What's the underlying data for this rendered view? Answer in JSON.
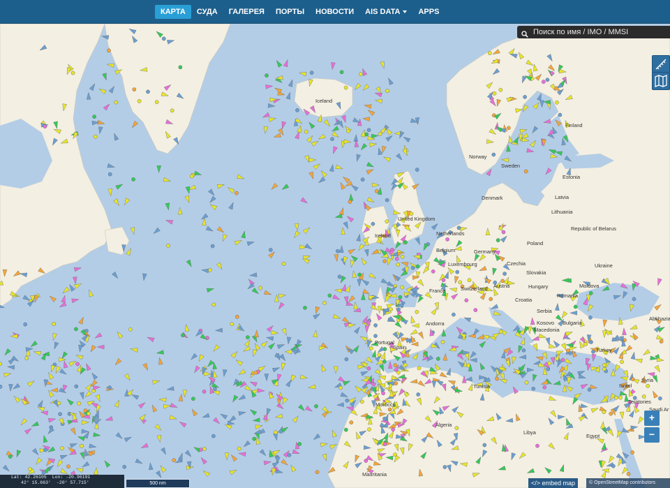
{
  "nav": {
    "items": [
      {
        "label": "КАРТА",
        "active": true
      },
      {
        "label": "СУДА"
      },
      {
        "label": "ГАЛЕРЕЯ"
      },
      {
        "label": "ПОРТЫ"
      },
      {
        "label": "НОВОСТИ"
      },
      {
        "label": "AIS DATA",
        "dropdown": true
      },
      {
        "label": "APPS"
      }
    ]
  },
  "search": {
    "placeholder": "Поиск по имя / IMO / MMSI"
  },
  "map": {
    "countries": [
      "Iceland",
      "Norway",
      "Sweden",
      "Finland",
      "Estonia",
      "Latvia",
      "Lithuania",
      "Denmark",
      "United Kingdom",
      "Ireland",
      "Netherlands",
      "Germany",
      "Poland",
      "Republic of Belarus",
      "Belgium",
      "Luxembourg",
      "Czechia",
      "Slovakia",
      "Ukraine",
      "Moldova",
      "France",
      "Switzerland",
      "Austria",
      "Hungary",
      "Romania",
      "Croatia",
      "Serbia",
      "Bulgaria",
      "Kosovo",
      "Macedonia",
      "Andorra",
      "Portugal",
      "Spain",
      "Morocco",
      "Algeria",
      "Tunisia",
      "Libya",
      "Egypt",
      "Turkey",
      "Syria",
      "Israel",
      "Territories",
      "Saudi Ar",
      "Abkhazia",
      "Mauritania"
    ],
    "colors": {
      "water": "#b4cde6",
      "land": "#f3efe2",
      "cargo": "#e7e52c",
      "tanker": "#6b9fd1",
      "passenger": "#e86fd8",
      "fishing": "#f2a53a",
      "tug": "#35c85a"
    }
  },
  "controls": {
    "zoom_in": "+",
    "zoom_out": "−",
    "measure_icon": "ruler-icon",
    "layers_icon": "map-icon"
  },
  "footer": {
    "lat": "Lat: 42.26105",
    "lon": "Lon: -20.96191",
    "lat_dms": "42° 15.663'",
    "lon_dms": "-20° 57.715'",
    "scale": "500 nm",
    "embed": "</> embed map",
    "attribution": "© OpenStreetMap contributors"
  }
}
